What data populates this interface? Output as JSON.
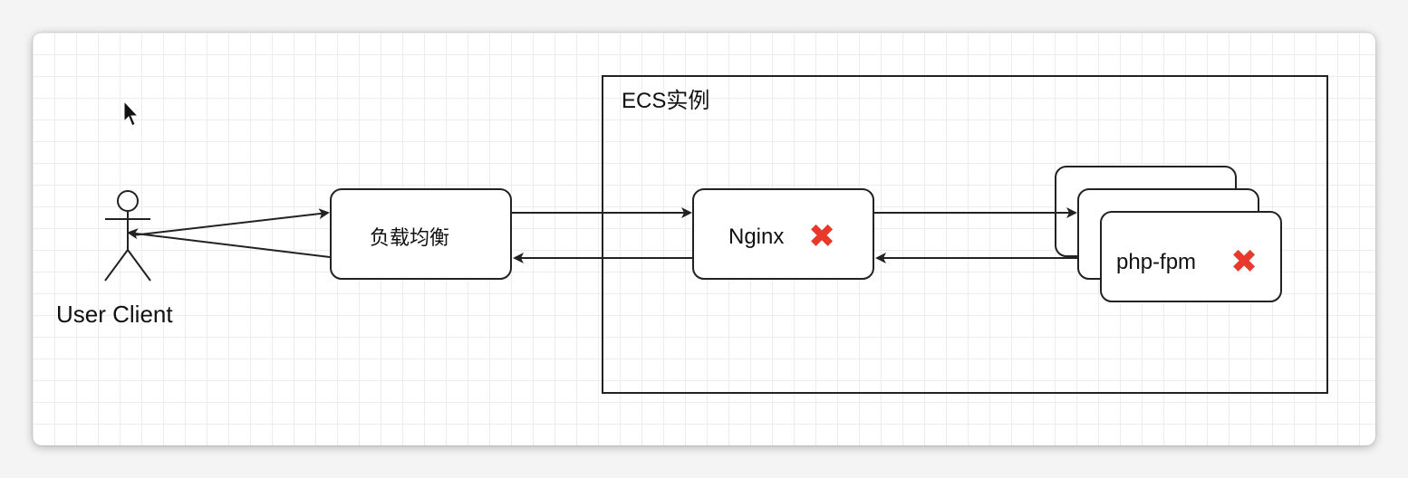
{
  "actor": {
    "label": "User Client"
  },
  "container": {
    "label": "ECS实例"
  },
  "nodes": {
    "load_balancer": {
      "label": "负载均衡"
    },
    "nginx": {
      "label": "Nginx",
      "status_icon": "red-x-icon"
    },
    "php_fpm": {
      "label": "php-fpm",
      "status_icon": "red-x-icon",
      "stacked_instances": 3
    }
  },
  "colors": {
    "stroke": "#222222",
    "error": "#e8392a",
    "grid": "#ececec"
  }
}
